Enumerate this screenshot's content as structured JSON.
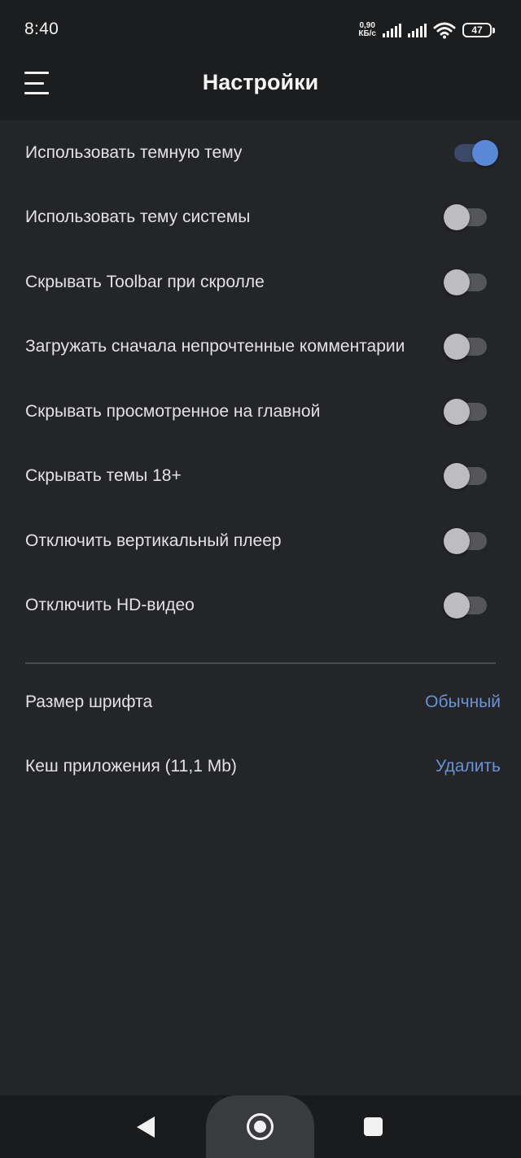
{
  "status_bar": {
    "time": "8:40",
    "net_speed_value": "0,90",
    "net_speed_unit": "КБ/с",
    "battery": "47"
  },
  "app_bar": {
    "title": "Настройки",
    "menu_icon": "hamburger-menu-icon"
  },
  "settings": [
    {
      "label": "Использовать темную тему",
      "enabled": true
    },
    {
      "label": "Использовать тему системы",
      "enabled": false
    },
    {
      "label": "Скрывать Toolbar при скролле",
      "enabled": false
    },
    {
      "label": "Загружать сначала непрочтенные комментарии",
      "enabled": false
    },
    {
      "label": "Скрывать просмотренное на главной",
      "enabled": false
    },
    {
      "label": "Скрывать темы 18+",
      "enabled": false
    },
    {
      "label": "Отключить вертикальный плеер",
      "enabled": false
    },
    {
      "label": "Отключить HD-видео",
      "enabled": false
    }
  ],
  "font_size": {
    "label": "Размер шрифта",
    "value": "Обычный"
  },
  "cache": {
    "label": "Кеш приложения (11,1 Mb)",
    "action": "Удалить"
  },
  "colors": {
    "background": "#242528",
    "accent": "#5a87d6",
    "link": "#6a92d6"
  },
  "nav_bar": {
    "back_icon": "back-triangle-icon",
    "home_icon": "home-circle-icon",
    "recents_icon": "recents-square-icon"
  }
}
